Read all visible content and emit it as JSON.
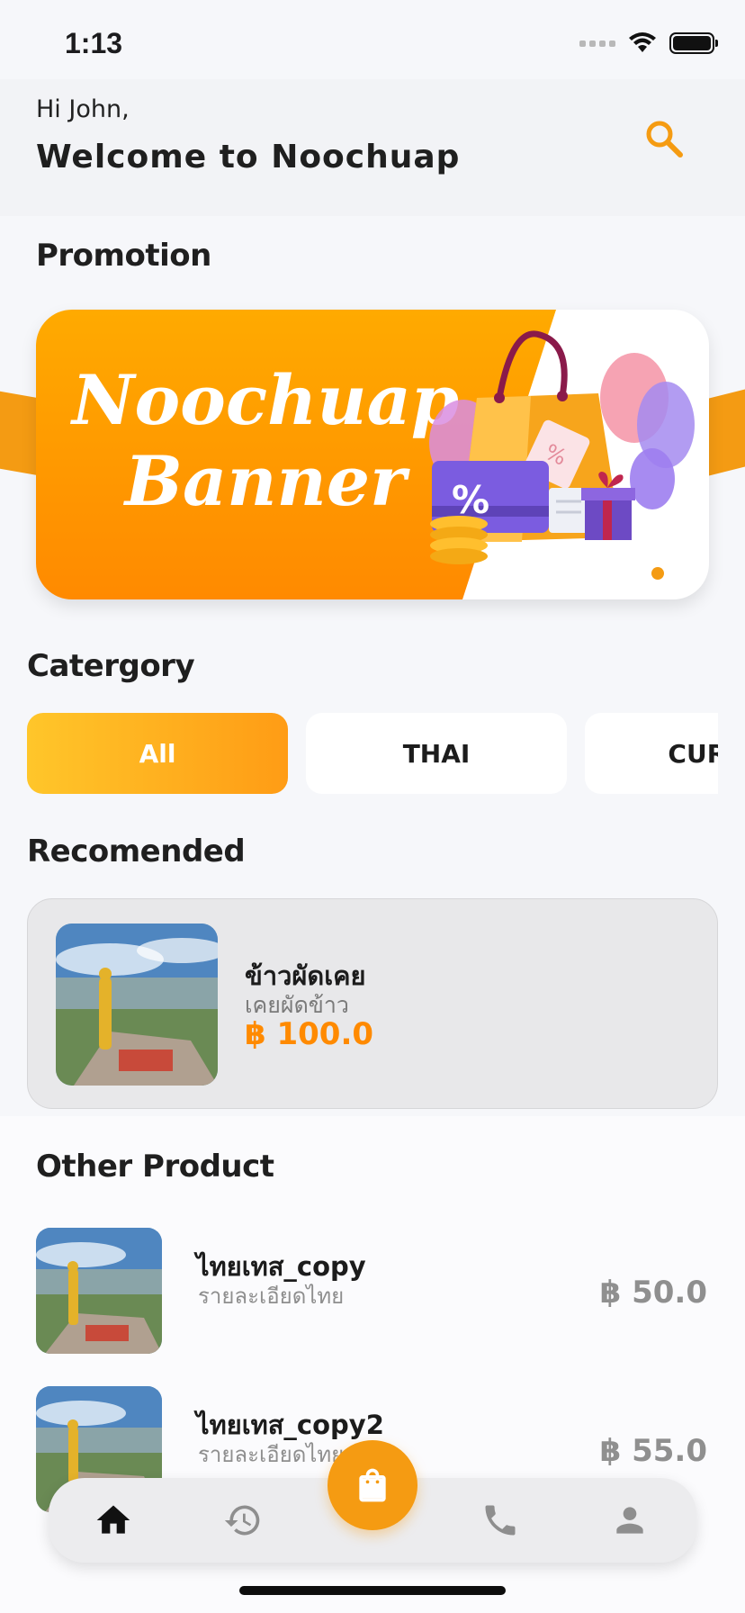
{
  "status_bar": {
    "time": "1:13"
  },
  "header": {
    "greeting": "Hi John,",
    "welcome": "Welcome to Noochuap"
  },
  "promotion": {
    "title": "Promotion",
    "banner_line1": "Noochuap",
    "banner_line2": "Banner"
  },
  "category": {
    "title": "Catergory",
    "chips": [
      "All",
      "THAI",
      "CURRY"
    ],
    "selected": "All"
  },
  "recommended": {
    "title": "Recomended",
    "item": {
      "name": "ข้าวผัดเคย",
      "description": "เคยผัดข้าว",
      "price": "฿ 100.0"
    }
  },
  "other_products": {
    "title": "Other Product",
    "items": [
      {
        "name": "ไทยเทส_copy",
        "description": "รายละเอียดไทย",
        "price": "฿ 50.0"
      },
      {
        "name": "ไทยเทส_copy2",
        "description": "รายละเอียดไทย",
        "price": "฿ 55.0"
      }
    ]
  },
  "bottom_nav": {
    "items": [
      "home-icon",
      "history-icon",
      "cart-bag-icon",
      "phone-icon",
      "person-icon"
    ],
    "active": "home-icon"
  },
  "colors": {
    "accent": "#f59b12",
    "price": "#ff8a00",
    "inactive_icon": "#8e8e8e"
  }
}
